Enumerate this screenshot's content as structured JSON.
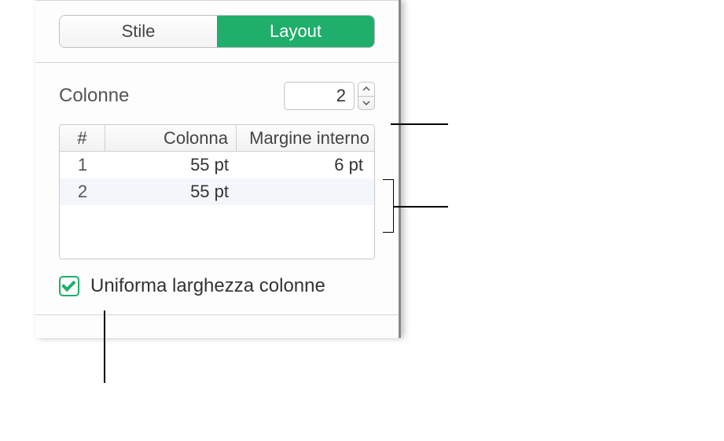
{
  "tabs": {
    "style": "Stile",
    "layout": "Layout"
  },
  "columns": {
    "label": "Colonne",
    "count": "2",
    "headers": {
      "index": "#",
      "column": "Colonna",
      "margin": "Margine interno"
    },
    "rows": [
      {
        "idx": "1",
        "col": "55 pt",
        "mar": "6 pt"
      },
      {
        "idx": "2",
        "col": "55 pt",
        "mar": ""
      }
    ],
    "equal_width_label": "Uniforma larghezza colonne",
    "equal_width_checked": true
  }
}
